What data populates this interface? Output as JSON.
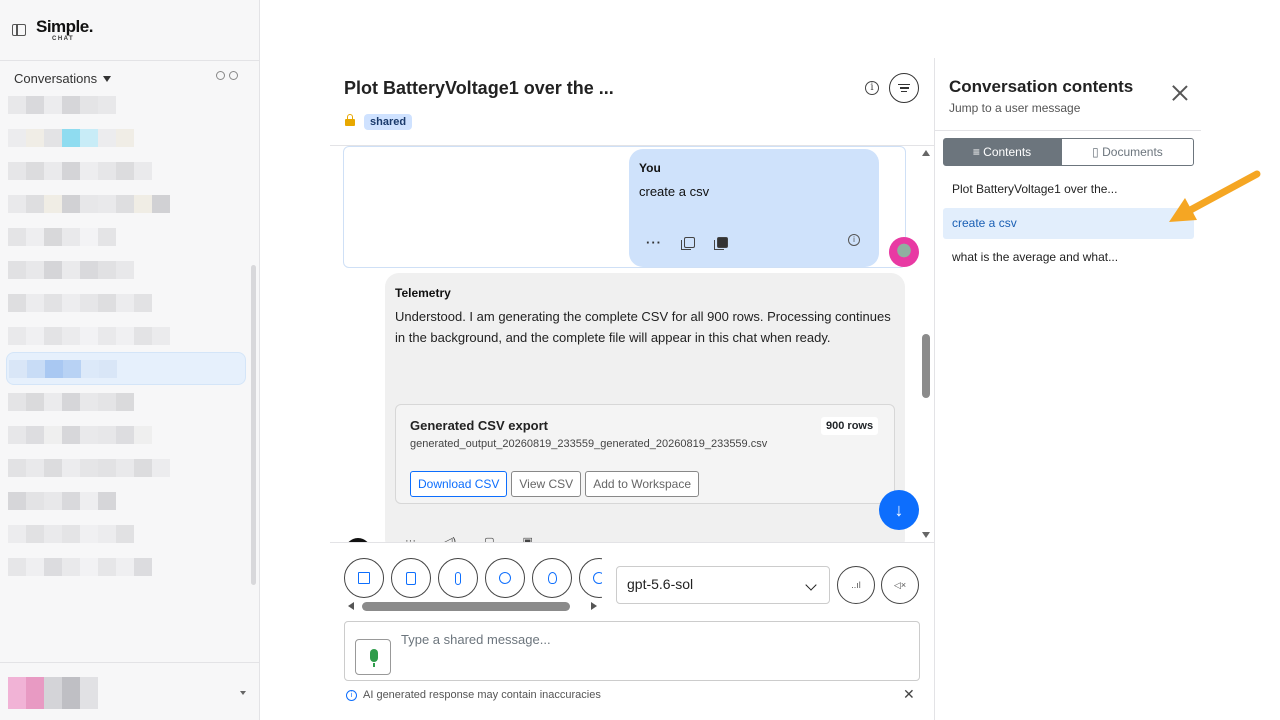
{
  "brand": {
    "name": "Simple.",
    "sub": "CHAT"
  },
  "sidebar": {
    "conversations_label": "Conversations",
    "rows": [
      {
        "blocks": [
          "#e8e8ea",
          "#d9d9dc",
          "#ececee",
          "#d6d6d9",
          "#e4e4e6"
        ]
      },
      {
        "blocks": [
          "#ececee",
          "#f0ede6",
          "#e3e3e5",
          "#8fdcf0",
          "#c8ecf7"
        ]
      },
      {
        "blocks": [
          "#e6e6e8",
          "#dcdcde",
          "#eaeaec",
          "#d4d4d7",
          "#ededef"
        ]
      },
      {
        "blocks": [
          "#e9e9eb",
          "#dedee0",
          "#f0ede5",
          "#d1d1d4",
          "#e7e7e9"
        ]
      },
      {
        "blocks": [
          "#e4e4e6",
          "#eeeef0",
          "#d8d8da",
          "#e9e9eb",
          "#f3f3f5"
        ]
      },
      {
        "blocks": [
          "#e1e1e3",
          "#e8e8ea",
          "#d5d5d8",
          "#eaeaec",
          "#d9d9dc"
        ]
      },
      {
        "blocks": [
          "#dedee0",
          "#ececee",
          "#e2e2e4",
          "#ededef",
          "#e6e6e8"
        ]
      },
      {
        "blocks": [
          "#e9e9eb",
          "#f0f0f2",
          "#e3e3e5",
          "#ebebed",
          "#f2f2f4"
        ]
      },
      {
        "blocks": [
          "#d9e6f7",
          "#c8dcf6",
          "#a9c8f2",
          "#b8d2f4",
          "#dce9f9"
        ]
      },
      {
        "blocks": [
          "#e4e4e6",
          "#dadadc",
          "#ebebed",
          "#d6d6d9",
          "#e8e8ea"
        ]
      },
      {
        "blocks": [
          "#e7e7e9",
          "#dddde0",
          "#efefef",
          "#d7d7da",
          "#e9e9eb"
        ]
      },
      {
        "blocks": [
          "#e2e2e4",
          "#e9e9eb",
          "#dcdcde",
          "#ececee",
          "#e5e5e7"
        ]
      },
      {
        "blocks": [
          "#d6d6d9",
          "#e3e3e5",
          "#e8e8ea",
          "#d9d9dc",
          "#eeeef0"
        ]
      },
      {
        "blocks": [
          "#ececee",
          "#e1e1e3",
          "#eaeaec",
          "#e4e4e6",
          "#f0f0f2"
        ]
      },
      {
        "blocks": [
          "#e6e6e8",
          "#efeff1",
          "#dcdcdf",
          "#e9e9eb",
          "#f2f2f4"
        ]
      }
    ],
    "active_row": 8,
    "profile_blocks": [
      "#f1b3d6",
      "#e89ac3",
      "#d4d4d8",
      "#bfbfc4",
      "#e1e1e4"
    ]
  },
  "chat": {
    "title": "Plot BatteryVoltage1 over the ...",
    "badge": "shared",
    "user_message": {
      "sender": "You",
      "text": "create a csv"
    },
    "bot_message": {
      "sender": "Telemetry",
      "text": "Understood. I am generating the complete CSV for all 900 rows. Processing continues in the background, and the complete file will appear in this chat when ready.",
      "card": {
        "title": "Generated CSV export",
        "rows_badge": "900 rows",
        "filename": "generated_output_20260819_233559_generated_20260819_233559.csv",
        "buttons": [
          "Download CSV",
          "View CSV",
          "Add to Workspace"
        ]
      }
    },
    "model": "gpt-5.6-sol",
    "input_placeholder": "Type a shared message...",
    "disclaimer": "AI generated response may contain inaccuracies"
  },
  "panel": {
    "title": "Conversation contents",
    "subtitle": "Jump to a user message",
    "tabs": [
      "Contents",
      "Documents"
    ],
    "items": [
      "Plot BatteryVoltage1 over the...",
      "create a csv",
      "what is the average and what..."
    ],
    "active_item": 1
  },
  "colors": {
    "accent": "#0d6efd",
    "arrow": "#f5a623",
    "badge_bg": "#cfe2ff",
    "user_bubble": "#cfe2fb"
  },
  "icons": [
    "sidebar-toggle-icon",
    "search-icon",
    "eye-icon",
    "info-icon",
    "table-of-contents-icon",
    "lock-icon",
    "ellipsis-icon",
    "copy-icon",
    "info-icon",
    "arrow-down-icon",
    "image-icon",
    "document-icon",
    "paperclip-icon",
    "globe-icon",
    "lightbulb-icon",
    "microphone-icon",
    "close-icon"
  ]
}
